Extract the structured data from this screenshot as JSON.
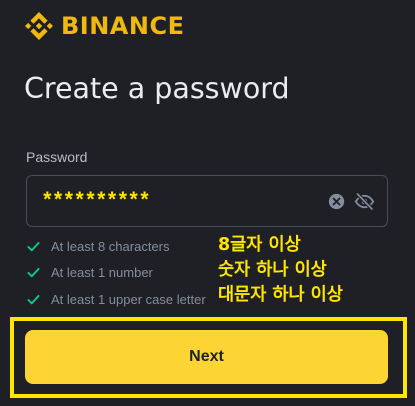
{
  "brand": {
    "name": "BINANCE",
    "logo_icon": "binance-logo-icon",
    "color": "#f0b90b"
  },
  "page": {
    "title": "Create a password"
  },
  "password_field": {
    "label": "Password",
    "masked_value": "**********",
    "value_color": "#ffe500",
    "clear_icon": "clear-circle-x-icon",
    "toggle_icon": "eye-slash-icon"
  },
  "requirements": {
    "check_icon": "check-icon",
    "check_color": "#0ecb81",
    "items": [
      {
        "label": "At least 8 characters"
      },
      {
        "label": "At least 1 number"
      },
      {
        "label": "At least 1 upper case letter"
      }
    ]
  },
  "annotation": {
    "color": "#ffe500",
    "lines": [
      "8글자 이상",
      "숫자 하나 이상",
      "대문자 하나 이상"
    ]
  },
  "next_button": {
    "label": "Next",
    "color": "#fcd535"
  },
  "highlight": {
    "color": "#ffe500"
  }
}
